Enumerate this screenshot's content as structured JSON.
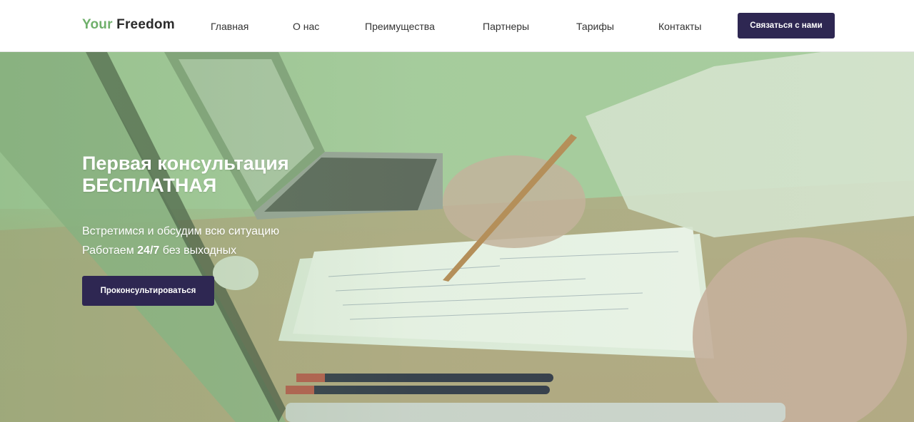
{
  "brand": {
    "logo_part1": "Your",
    "logo_part2": "Freedom",
    "accent": "#6fb06b"
  },
  "nav": {
    "items": [
      {
        "label": "Главная"
      },
      {
        "label": "О нас"
      },
      {
        "label": "Преимущества"
      },
      {
        "label": "Партнеры"
      },
      {
        "label": "Тарифы"
      },
      {
        "label": "Контакты"
      }
    ],
    "cta_label": "Связаться с нами"
  },
  "hero": {
    "title_line1": "Первая консультация",
    "title_line2": "БЕСПЛАТНАЯ",
    "subtitle_line1": "Встретимся и обсудим всю ситуацию",
    "subtitle_line2_prefix": "Работаем",
    "subtitle_line2_bold": "24/7",
    "subtitle_line2_suffix": "без выходных",
    "cta_label": "Проконсультироваться"
  },
  "colors": {
    "button_bg": "#2e2752",
    "hero_tint": "#a9cf9f"
  }
}
